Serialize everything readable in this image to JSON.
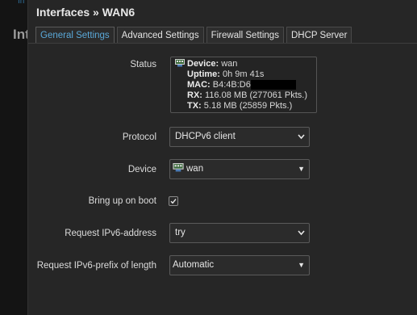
{
  "background": {
    "fragment_top": "In",
    "fragment_left": "Int"
  },
  "title": "Interfaces » WAN6",
  "tabs": [
    {
      "label": "General Settings",
      "active": true
    },
    {
      "label": "Advanced Settings",
      "active": false
    },
    {
      "label": "Firewall Settings",
      "active": false
    },
    {
      "label": "DHCP Server",
      "active": false
    }
  ],
  "status": {
    "label": "Status",
    "device_key": "Device:",
    "device_value": "wan",
    "uptime_key": "Uptime:",
    "uptime_value": "0h 9m 41s",
    "mac_key": "MAC:",
    "mac_value": "B4:4B:D6",
    "rx_key": "RX:",
    "rx_value": "116.08 MB (277061 Pkts.)",
    "tx_key": "TX:",
    "tx_value": "5.18 MB (25859 Pkts.)"
  },
  "fields": {
    "protocol": {
      "label": "Protocol",
      "value": "DHCPv6 client"
    },
    "device": {
      "label": "Device",
      "value": "wan"
    },
    "bring_up": {
      "label": "Bring up on boot",
      "checked": true
    },
    "request_address": {
      "label": "Request IPv6-address",
      "value": "try"
    },
    "request_prefix": {
      "label": "Request IPv6-prefix of length",
      "value": "Automatic"
    }
  },
  "colors": {
    "accent": "#5aa8d8",
    "background": "#262626"
  },
  "icons": {
    "device": "network-port-icon",
    "dropdown": "chevron-down-icon",
    "check": "checkmark-icon"
  }
}
